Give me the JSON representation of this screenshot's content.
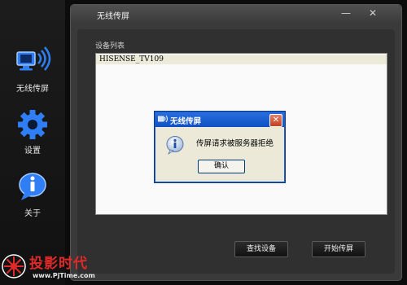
{
  "sidebar": {
    "items": [
      {
        "label": "无线传屏",
        "icon": "wireless-screen-icon"
      },
      {
        "label": "设置",
        "icon": "gear-icon"
      },
      {
        "label": "关于",
        "icon": "info-bubble-icon"
      }
    ]
  },
  "window": {
    "title": "无线传屏",
    "minimize_label": "—",
    "close_label": "✕"
  },
  "device_list": {
    "label": "设备列表",
    "items": [
      "HISENSE_TV109"
    ]
  },
  "buttons": {
    "find_devices": "查找设备",
    "start_cast": "开始传屏"
  },
  "dialog": {
    "title": "无线传屏",
    "message": "传屏请求被服务器拒绝",
    "ok_label": "确认",
    "close_label": "✕",
    "icon": "info-icon"
  },
  "watermark": {
    "text": "投影时代",
    "url": "www.PjTime.com"
  },
  "colors": {
    "accent_blue": "#2a6fde",
    "sidebar_icon_blue": "#2f7ef5",
    "watermark_red": "#e02a2a"
  }
}
